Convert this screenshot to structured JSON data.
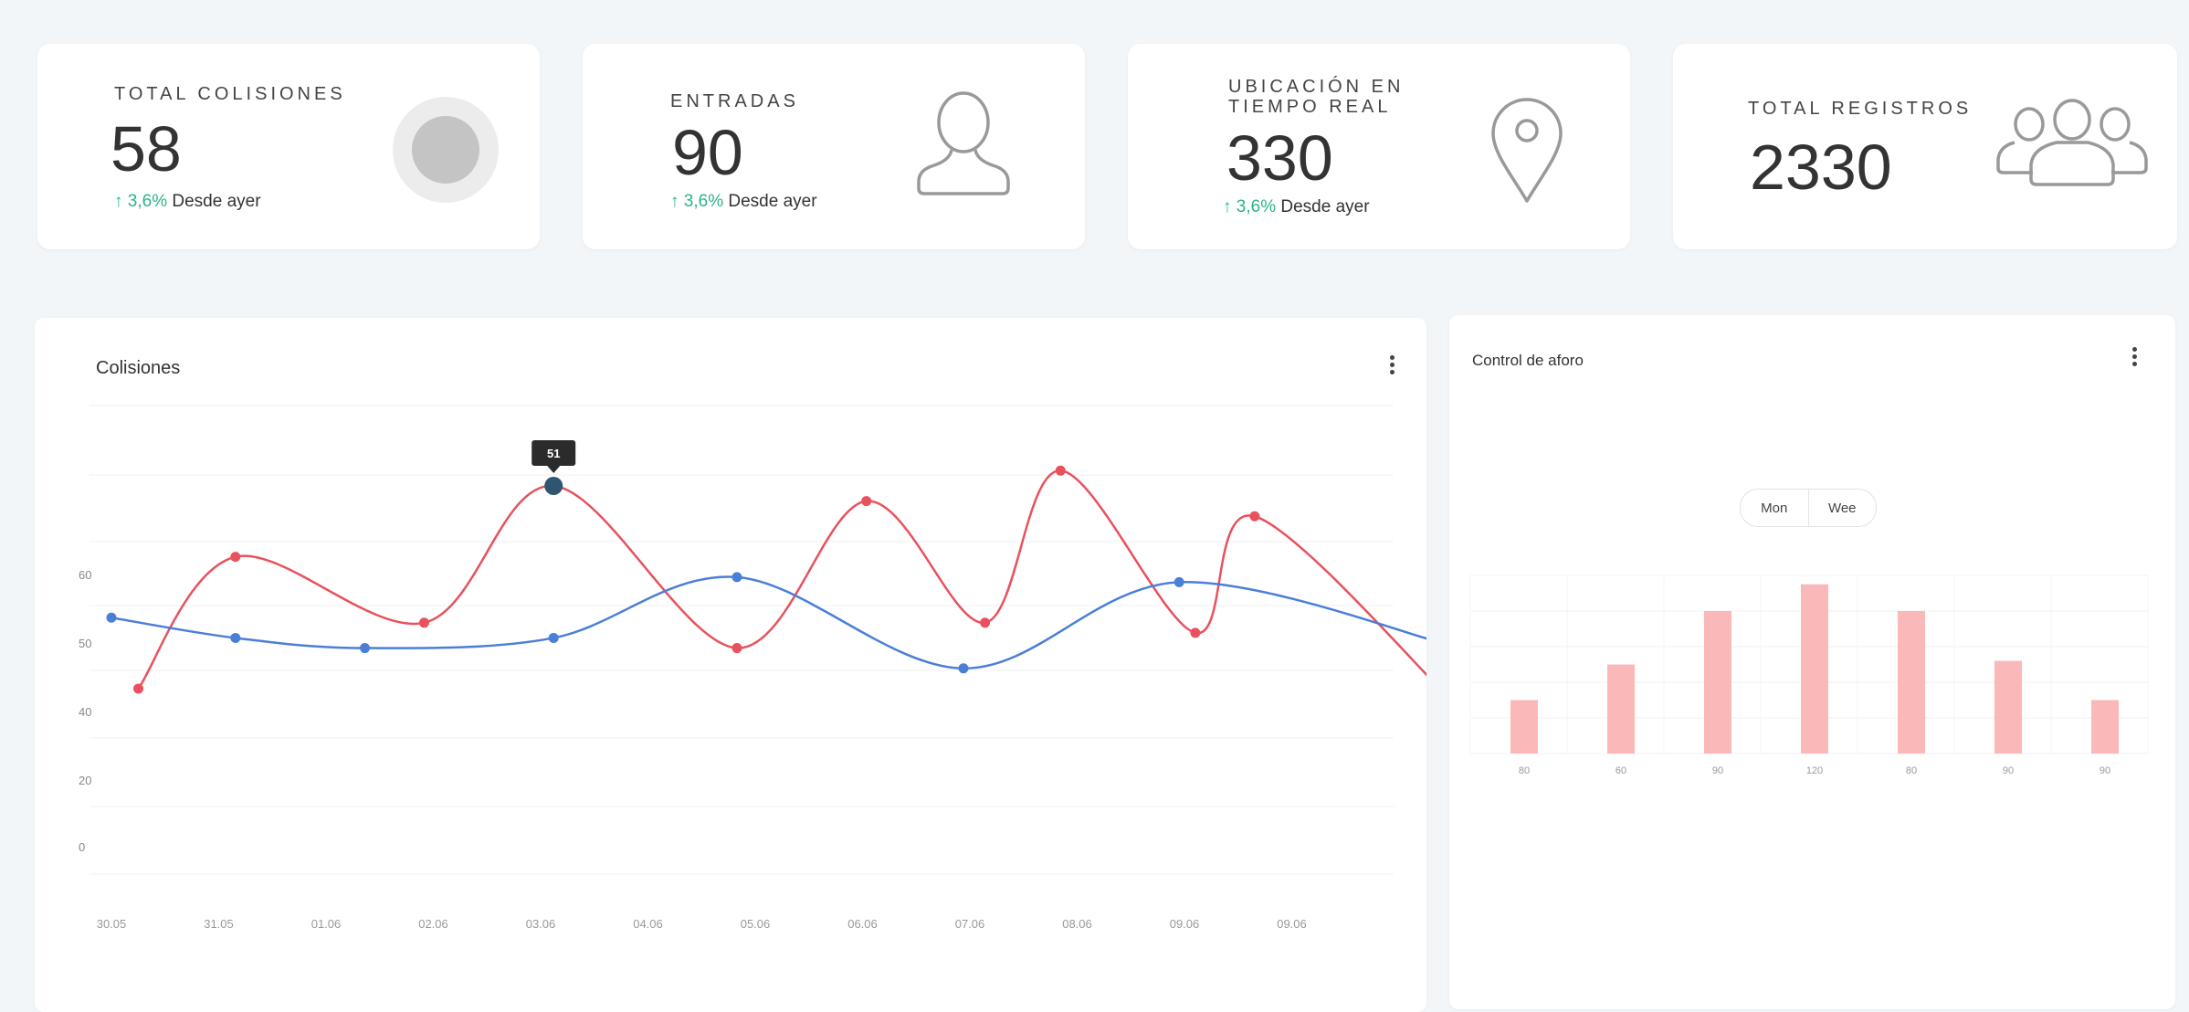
{
  "kpis": [
    {
      "title": "TOTAL COLISIONES",
      "value": "58",
      "trend_arrow": "↑",
      "trend_pct": "3,6%",
      "trend_text": "Desde ayer",
      "icon": "circle-icon"
    },
    {
      "title": "ENTRADAS",
      "value": "90",
      "trend_arrow": "↑",
      "trend_pct": "3,6%",
      "trend_text": "Desde ayer",
      "icon": "user-icon"
    },
    {
      "title": "UBICACIÓN EN\nTIEMPO REAL",
      "value": "330",
      "trend_arrow": "↑",
      "trend_pct": "3,6%",
      "trend_text": "Desde ayer",
      "icon": "location-pin-icon"
    },
    {
      "title": "TOTAL REGISTROS",
      "value": "2330",
      "icon": "users-group-icon"
    }
  ],
  "colisiones": {
    "title": "Colisiones",
    "menu_icon": "kebab-menu-icon"
  },
  "aforo": {
    "title": "Control de aforo",
    "menu_icon": "kebab-menu-icon",
    "toggle": [
      "Mon",
      "Wee"
    ]
  },
  "colors": {
    "accent_green": "#2bb38a",
    "red_series": "#e8515d",
    "blue_series": "#4a7fd8",
    "bar_fill": "#fbb8b8"
  },
  "chart_data": [
    {
      "type": "line",
      "title": "Colisiones",
      "x_ticks": [
        "30.05",
        "31.05",
        "01.06",
        "02.06",
        "03.06",
        "04.06",
        "05.06",
        "06.06",
        "07.06",
        "08.06",
        "09.06",
        "09.06"
      ],
      "y_ticks": [
        "0",
        "20",
        "40",
        "50",
        "60"
      ],
      "tooltip": {
        "label": "51"
      },
      "series": [
        {
          "color": "#e8515d",
          "points": [
            {
              "x": 0.25,
              "y": 31
            },
            {
              "x": 1.15,
              "y": 57
            },
            {
              "x": 2.9,
              "y": 44
            },
            {
              "x": 4.1,
              "y": 71
            },
            {
              "x": 5.8,
              "y": 39
            },
            {
              "x": 7.0,
              "y": 68
            },
            {
              "x": 8.1,
              "y": 44
            },
            {
              "x": 8.8,
              "y": 74
            },
            {
              "x": 10.05,
              "y": 42
            },
            {
              "x": 10.6,
              "y": 65
            },
            {
              "x": 12.5,
              "y": 27
            }
          ]
        },
        {
          "color": "#4a7fd8",
          "points": [
            {
              "x": 0,
              "y": 45
            },
            {
              "x": 1.15,
              "y": 41
            },
            {
              "x": 2.35,
              "y": 39
            },
            {
              "x": 4.1,
              "y": 41
            },
            {
              "x": 5.8,
              "y": 53
            },
            {
              "x": 7.9,
              "y": 35
            },
            {
              "x": 9.9,
              "y": 52
            },
            {
              "x": 12.5,
              "y": 39
            }
          ]
        }
      ],
      "highlight_point": {
        "x": 4.1,
        "y": 71
      },
      "grid": true
    },
    {
      "type": "bar",
      "title": "Control de aforo",
      "categories": [
        "80",
        "60",
        "90",
        "120",
        "80",
        "90",
        "90"
      ],
      "values": [
        30,
        50,
        80,
        95,
        80,
        52,
        30
      ],
      "ylim": [
        0,
        100
      ],
      "grid": true
    }
  ]
}
